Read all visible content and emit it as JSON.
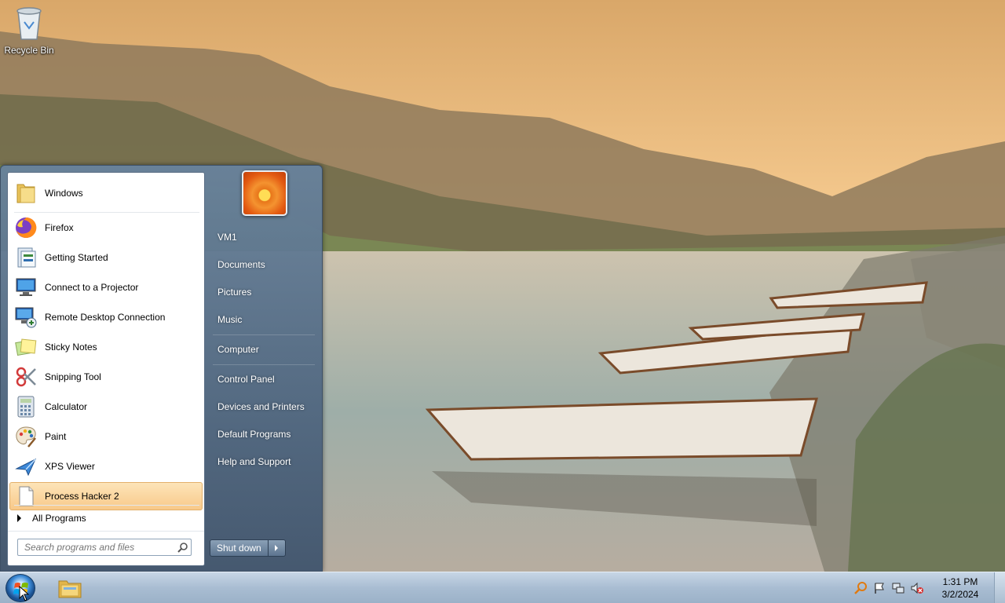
{
  "desktop": {
    "icons": [
      {
        "label": "Recycle Bin",
        "icon": "recycle-bin-icon"
      }
    ]
  },
  "start_menu": {
    "pinned": [
      {
        "label": "Windows",
        "icon": "folder-icon"
      }
    ],
    "programs": [
      {
        "label": "Firefox",
        "icon": "firefox-icon"
      },
      {
        "label": "Getting Started",
        "icon": "getting-started-icon"
      },
      {
        "label": "Connect to a Projector",
        "icon": "projector-icon"
      },
      {
        "label": "Remote Desktop Connection",
        "icon": "remote-desktop-icon"
      },
      {
        "label": "Sticky Notes",
        "icon": "sticky-notes-icon"
      },
      {
        "label": "Snipping Tool",
        "icon": "scissors-icon"
      },
      {
        "label": "Calculator",
        "icon": "calculator-icon"
      },
      {
        "label": "Paint",
        "icon": "paint-palette-icon"
      },
      {
        "label": "XPS Viewer",
        "icon": "xps-viewer-icon"
      },
      {
        "label": "Process Hacker 2",
        "icon": "document-icon",
        "highlighted": true
      }
    ],
    "all_programs_label": "All Programs",
    "search_placeholder": "Search programs and files",
    "right_links": [
      "VM1",
      "Documents",
      "Pictures",
      "Music",
      "Computer",
      "Control Panel",
      "Devices and Printers",
      "Default Programs",
      "Help and Support"
    ],
    "shutdown_label": "Shut down"
  },
  "taskbar": {
    "tray_icons": [
      "search-icon",
      "flag-icon",
      "network-icon",
      "volume-muted-icon"
    ],
    "clock_time": "1:31 PM",
    "clock_date": "3/2/2024"
  },
  "colors": {
    "highlight": "#f8c98a",
    "menu_blue": "#5d7590",
    "taskbar": "#a9bdd2"
  }
}
